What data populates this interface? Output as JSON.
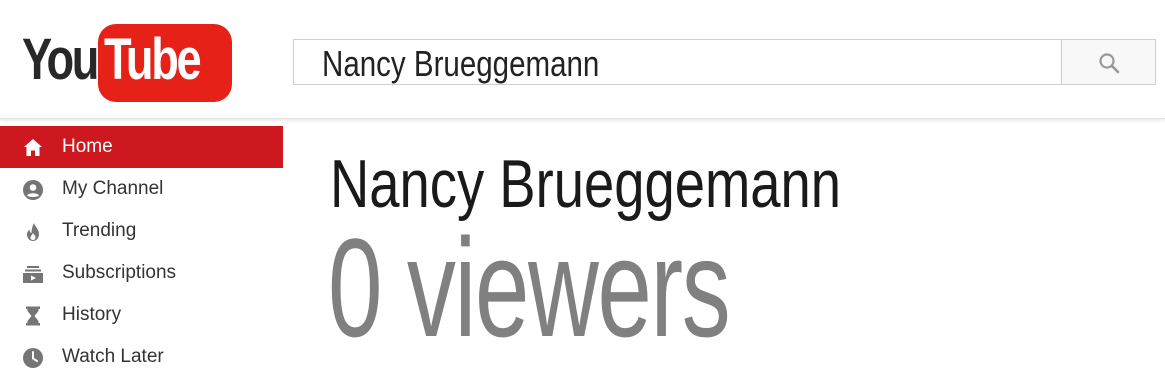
{
  "logo": {
    "you": "You",
    "tube": "Tube"
  },
  "search": {
    "value": "Nancy Brueggemann",
    "button_icon": "search-icon"
  },
  "sidebar": {
    "items": [
      {
        "label": "Home",
        "icon": "home-icon",
        "active": true
      },
      {
        "label": "My Channel",
        "icon": "account-icon",
        "active": false
      },
      {
        "label": "Trending",
        "icon": "flame-icon",
        "active": false
      },
      {
        "label": "Subscriptions",
        "icon": "subscriptions-icon",
        "active": false
      },
      {
        "label": "History",
        "icon": "hourglass-icon",
        "active": false
      },
      {
        "label": "Watch Later",
        "icon": "clock-icon",
        "active": false
      }
    ]
  },
  "main": {
    "channel_name": "Nancy Brueggemann",
    "viewers": "0 viewers"
  },
  "colors": {
    "brand_red": "#e62117",
    "active_nav": "#cc181e",
    "viewers_gray": "#808080"
  }
}
